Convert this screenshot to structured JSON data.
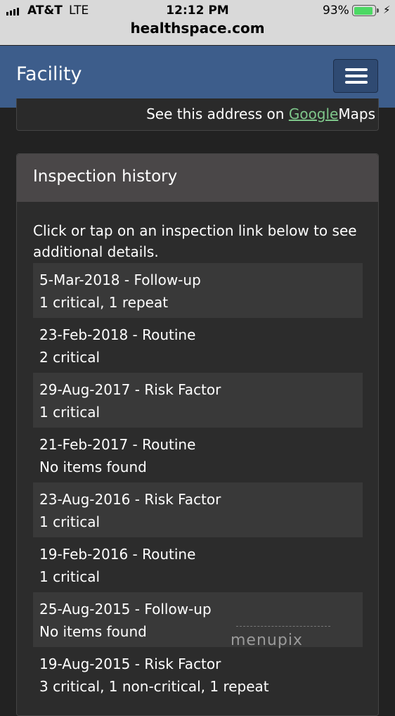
{
  "status_bar": {
    "carrier": "AT&T",
    "network": "LTE",
    "time": "12:12 PM",
    "battery_percent": "93%",
    "battery_level": 0.93,
    "charging_icon": "bolt-icon",
    "url": "healthspace.com"
  },
  "navbar": {
    "brand": "Facility",
    "menu_icon": "hamburger-menu-icon"
  },
  "address": {
    "prefix": "See this address on",
    "link_text": "Google",
    "suffix": "Maps"
  },
  "inspections": {
    "title": "Inspection history",
    "intro": "Click or tap on an inspection link below to see additional details.",
    "items": [
      {
        "date_type": "5-Mar-2018 - Follow-up",
        "summary": "1 critical, 1 repeat"
      },
      {
        "date_type": "23-Feb-2018 - Routine",
        "summary": "2 critical"
      },
      {
        "date_type": "29-Aug-2017 - Risk Factor",
        "summary": "1 critical"
      },
      {
        "date_type": "21-Feb-2017 - Routine",
        "summary": "No items found"
      },
      {
        "date_type": "23-Aug-2016 - Risk Factor",
        "summary": "1 critical"
      },
      {
        "date_type": "19-Feb-2016 - Routine",
        "summary": "1 critical"
      },
      {
        "date_type": "25-Aug-2015 - Follow-up",
        "summary": "No items found"
      },
      {
        "date_type": "19-Aug-2015 - Risk Factor",
        "summary": "3 critical, 1 non-critical, 1 repeat"
      }
    ]
  },
  "watermark": "menupix",
  "colors": {
    "navbar": "#3d5d8b",
    "background": "#222222",
    "link": "#7ec68a",
    "battery": "#4cd964"
  }
}
